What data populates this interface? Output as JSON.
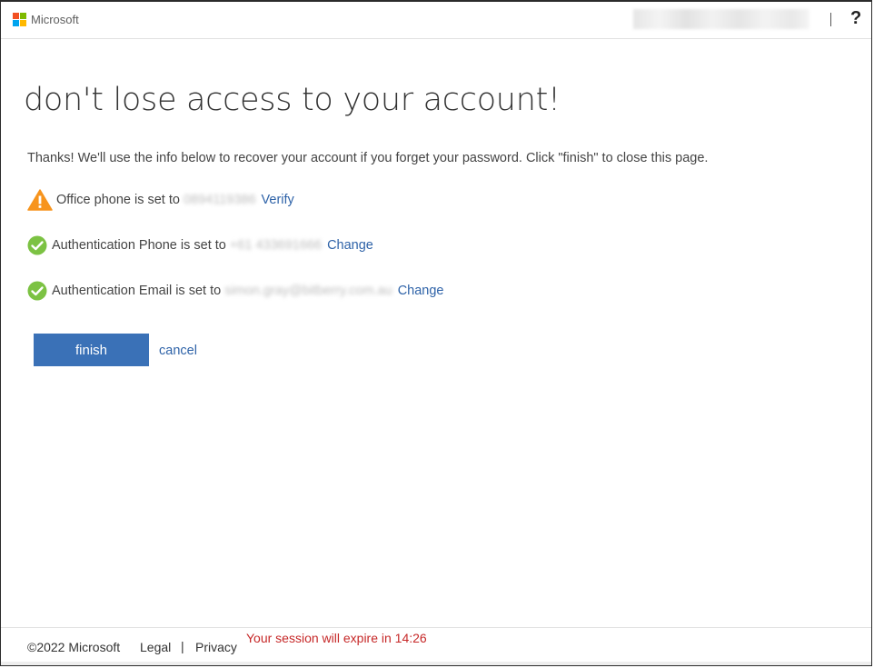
{
  "header": {
    "brand": "Microsoft",
    "help_label": "?"
  },
  "main": {
    "title": "don't lose access to your account!",
    "intro": "Thanks! We'll use the info below to recover your account if you forget your password. Click \"finish\" to close this page.",
    "items": [
      {
        "label": "Office phone is set to",
        "value": "0894119386",
        "action": "Verify",
        "status": "warning"
      },
      {
        "label": "Authentication Phone is set to",
        "value": "+61 433691666",
        "action": "Change",
        "status": "ok"
      },
      {
        "label": "Authentication Email is set to",
        "value": "simon.gray@bitberry.com.au",
        "action": "Change",
        "status": "ok"
      }
    ],
    "finish_label": "finish",
    "cancel_label": "cancel"
  },
  "footer": {
    "copyright": "©2022 Microsoft",
    "legal": "Legal",
    "separator": "|",
    "privacy": "Privacy",
    "session_text": "Your session will expire in 14:26"
  },
  "colors": {
    "accent": "#3a71b7",
    "link": "#2f63a8",
    "warning": "#f7941d",
    "success": "#7cc243",
    "session": "#c62828"
  }
}
